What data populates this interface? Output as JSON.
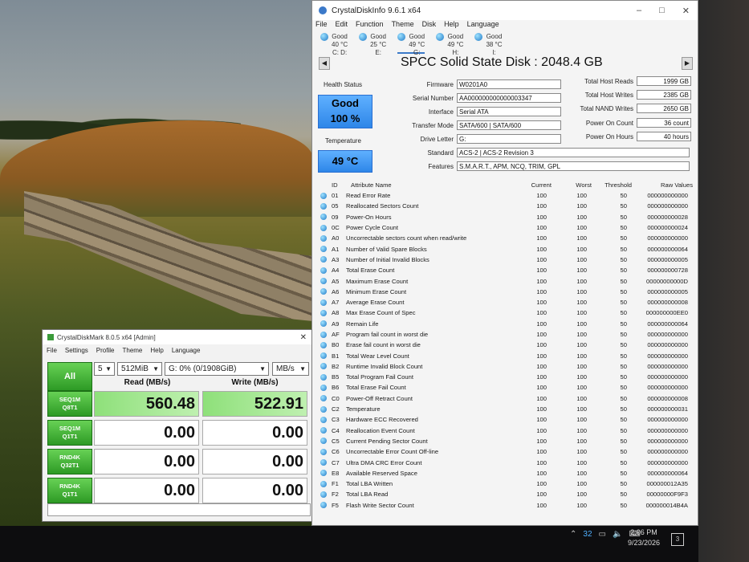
{
  "cdi": {
    "title": "CrystalDiskInfo 9.6.1 x64",
    "menu": [
      "File",
      "Edit",
      "Function",
      "Theme",
      "Disk",
      "Help",
      "Language"
    ],
    "drives": [
      {
        "status": "Good",
        "temp": "40 °C",
        "letter": "C: D:"
      },
      {
        "status": "Good",
        "temp": "25 °C",
        "letter": "E:"
      },
      {
        "status": "Good",
        "temp": "49 °C",
        "letter": "G:"
      },
      {
        "status": "Good",
        "temp": "49 °C",
        "letter": "H:"
      },
      {
        "status": "Good",
        "temp": "38 °C",
        "letter": "I:"
      }
    ],
    "disk_title": "SPCC Solid State Disk : 2048.4 GB",
    "health_label": "Health Status",
    "health_status": "Good",
    "health_percent": "100 %",
    "temp_label": "Temperature",
    "temperature": "49 °C",
    "info": {
      "firmware_label": "Firmware",
      "firmware": "W0201A0",
      "serial_label": "Serial Number",
      "serial": "AA000000000000003347",
      "interface_label": "Interface",
      "interface": "Serial ATA",
      "transfer_label": "Transfer Mode",
      "transfer": "SATA/600 | SATA/600",
      "drive_letter_label": "Drive Letter",
      "drive_letter": "G:",
      "standard_label": "Standard",
      "standard": "ACS-2 | ACS-2 Revision 3",
      "features_label": "Features",
      "features": "S.M.A.R.T., APM, NCQ, TRIM, GPL",
      "host_reads_label": "Total Host Reads",
      "host_reads": "1999 GB",
      "host_writes_label": "Total Host Writes",
      "host_writes": "2385 GB",
      "nand_writes_label": "Total NAND Writes",
      "nand_writes": "2650 GB",
      "power_count_label": "Power On Count",
      "power_count": "36 count",
      "power_hours_label": "Power On Hours",
      "power_hours": "40 hours"
    },
    "columns": {
      "id": "ID",
      "name": "Attribute Name",
      "current": "Current",
      "worst": "Worst",
      "threshold": "Threshold",
      "raw": "Raw Values"
    },
    "attributes": [
      {
        "id": "01",
        "name": "Read Error Rate",
        "cur": "100",
        "wor": "100",
        "thr": "50",
        "raw": "000000000000"
      },
      {
        "id": "05",
        "name": "Reallocated Sectors Count",
        "cur": "100",
        "wor": "100",
        "thr": "50",
        "raw": "000000000000"
      },
      {
        "id": "09",
        "name": "Power-On Hours",
        "cur": "100",
        "wor": "100",
        "thr": "50",
        "raw": "000000000028"
      },
      {
        "id": "0C",
        "name": "Power Cycle Count",
        "cur": "100",
        "wor": "100",
        "thr": "50",
        "raw": "000000000024"
      },
      {
        "id": "A0",
        "name": "Uncorrectable sectors count when read/write",
        "cur": "100",
        "wor": "100",
        "thr": "50",
        "raw": "000000000000"
      },
      {
        "id": "A1",
        "name": "Number of Valid Spare Blocks",
        "cur": "100",
        "wor": "100",
        "thr": "50",
        "raw": "000000000064"
      },
      {
        "id": "A3",
        "name": "Number of Initial Invalid Blocks",
        "cur": "100",
        "wor": "100",
        "thr": "50",
        "raw": "000000000005"
      },
      {
        "id": "A4",
        "name": "Total Erase Count",
        "cur": "100",
        "wor": "100",
        "thr": "50",
        "raw": "000000000728"
      },
      {
        "id": "A5",
        "name": "Maximum Erase Count",
        "cur": "100",
        "wor": "100",
        "thr": "50",
        "raw": "00000000000D"
      },
      {
        "id": "A6",
        "name": "Minimum Erase Count",
        "cur": "100",
        "wor": "100",
        "thr": "50",
        "raw": "000000000005"
      },
      {
        "id": "A7",
        "name": "Average Erase Count",
        "cur": "100",
        "wor": "100",
        "thr": "50",
        "raw": "000000000008"
      },
      {
        "id": "A8",
        "name": "Max Erase Count of Spec",
        "cur": "100",
        "wor": "100",
        "thr": "50",
        "raw": "000000000EE0"
      },
      {
        "id": "A9",
        "name": "Remain Life",
        "cur": "100",
        "wor": "100",
        "thr": "50",
        "raw": "000000000064"
      },
      {
        "id": "AF",
        "name": "Program fail count in worst die",
        "cur": "100",
        "wor": "100",
        "thr": "50",
        "raw": "000000000000"
      },
      {
        "id": "B0",
        "name": "Erase fail count in worst die",
        "cur": "100",
        "wor": "100",
        "thr": "50",
        "raw": "000000000000"
      },
      {
        "id": "B1",
        "name": "Total Wear Level Count",
        "cur": "100",
        "wor": "100",
        "thr": "50",
        "raw": "000000000000"
      },
      {
        "id": "B2",
        "name": "Runtime Invalid Block Count",
        "cur": "100",
        "wor": "100",
        "thr": "50",
        "raw": "000000000000"
      },
      {
        "id": "B5",
        "name": "Total Program Fail Count",
        "cur": "100",
        "wor": "100",
        "thr": "50",
        "raw": "000000000000"
      },
      {
        "id": "B6",
        "name": "Total Erase Fail Count",
        "cur": "100",
        "wor": "100",
        "thr": "50",
        "raw": "000000000000"
      },
      {
        "id": "C0",
        "name": "Power-Off Retract Count",
        "cur": "100",
        "wor": "100",
        "thr": "50",
        "raw": "000000000008"
      },
      {
        "id": "C2",
        "name": "Temperature",
        "cur": "100",
        "wor": "100",
        "thr": "50",
        "raw": "000000000031"
      },
      {
        "id": "C3",
        "name": "Hardware ECC Recovered",
        "cur": "100",
        "wor": "100",
        "thr": "50",
        "raw": "000000000000"
      },
      {
        "id": "C4",
        "name": "Reallocation Event Count",
        "cur": "100",
        "wor": "100",
        "thr": "50",
        "raw": "000000000000"
      },
      {
        "id": "C5",
        "name": "Current Pending Sector Count",
        "cur": "100",
        "wor": "100",
        "thr": "50",
        "raw": "000000000000"
      },
      {
        "id": "C6",
        "name": "Uncorrectable Error Count Off-line",
        "cur": "100",
        "wor": "100",
        "thr": "50",
        "raw": "000000000000"
      },
      {
        "id": "C7",
        "name": "Ultra DMA CRC Error Count",
        "cur": "100",
        "wor": "100",
        "thr": "50",
        "raw": "000000000000"
      },
      {
        "id": "E8",
        "name": "Available Reserved Space",
        "cur": "100",
        "wor": "100",
        "thr": "50",
        "raw": "000000000064"
      },
      {
        "id": "F1",
        "name": "Total LBA Written",
        "cur": "100",
        "wor": "100",
        "thr": "50",
        "raw": "000000012A35"
      },
      {
        "id": "F2",
        "name": "Total LBA Read",
        "cur": "100",
        "wor": "100",
        "thr": "50",
        "raw": "00000000F9F3"
      },
      {
        "id": "F5",
        "name": "Flash Write Sector Count",
        "cur": "100",
        "wor": "100",
        "thr": "50",
        "raw": "000000014B4A"
      }
    ]
  },
  "cdm": {
    "title": "CrystalDiskMark 8.0.5 x64 [Admin]",
    "menu": [
      "File",
      "Settings",
      "Profile",
      "Theme",
      "Help",
      "Language"
    ],
    "all_label": "All",
    "count": "5",
    "size": "512MiB",
    "drive": "G: 0% (0/1908GiB)",
    "unit": "MB/s",
    "read_header": "Read (MB/s)",
    "write_header": "Write (MB/s)",
    "tests": [
      {
        "line1": "SEQ1M",
        "line2": "Q8T1",
        "read": "560.48",
        "write": "522.91"
      },
      {
        "line1": "SEQ1M",
        "line2": "Q1T1",
        "read": "0.00",
        "write": "0.00"
      },
      {
        "line1": "RND4K",
        "line2": "Q32T1",
        "read": "0.00",
        "write": "0.00"
      },
      {
        "line1": "RND4K",
        "line2": "Q1T1",
        "read": "0.00",
        "write": "0.00"
      }
    ]
  },
  "taskbar": {
    "tray_number": "32",
    "time": "2:06 PM",
    "date": "9/23/2026",
    "notification_count": "3"
  }
}
